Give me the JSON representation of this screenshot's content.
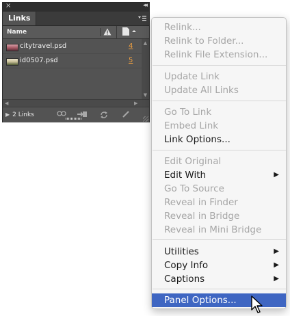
{
  "panel": {
    "tab_label": "Links",
    "close_glyph": "×",
    "collapse_glyph": "◂◂",
    "menu_glyph": "☰",
    "columns": {
      "name": "Name",
      "status_icon": "warning-icon",
      "page_icon": "page-icon"
    },
    "links": [
      {
        "name": "citytravel.psd",
        "page": "4"
      },
      {
        "name": "id0507.psd",
        "page": "5"
      }
    ],
    "footer": {
      "count": "2 Links"
    }
  },
  "menu": {
    "items": [
      {
        "label": "Relink...",
        "enabled": false
      },
      {
        "label": "Relink to Folder...",
        "enabled": false
      },
      {
        "label": "Relink File Extension...",
        "enabled": false
      },
      {
        "label": "Update Link",
        "enabled": false
      },
      {
        "label": "Update All Links",
        "enabled": false
      },
      {
        "label": "Go To Link",
        "enabled": false
      },
      {
        "label": "Embed Link",
        "enabled": false
      },
      {
        "label": "Link Options...",
        "enabled": true
      },
      {
        "label": "Edit Original",
        "enabled": false
      },
      {
        "label": "Edit With",
        "enabled": true,
        "submenu": true
      },
      {
        "label": "Go To Source",
        "enabled": false
      },
      {
        "label": "Reveal in Finder",
        "enabled": false
      },
      {
        "label": "Reveal in Bridge",
        "enabled": false
      },
      {
        "label": "Reveal in Mini Bridge",
        "enabled": false
      },
      {
        "label": "Utilities",
        "enabled": true,
        "submenu": true
      },
      {
        "label": "Copy Info",
        "enabled": true,
        "submenu": true
      },
      {
        "label": "Captions",
        "enabled": true,
        "submenu": true
      },
      {
        "label": "Panel Options...",
        "enabled": true,
        "highlighted": true
      }
    ]
  },
  "colors": {
    "highlight": "#3f66c2",
    "panel_bg": "#535353",
    "page_number": "#f0a040"
  }
}
